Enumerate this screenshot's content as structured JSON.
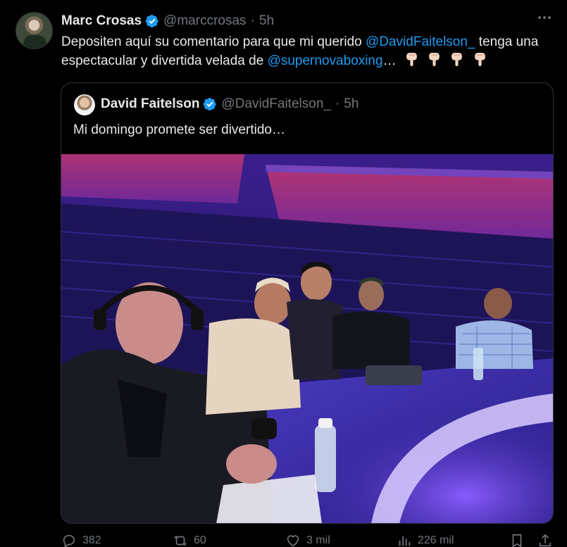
{
  "tweet": {
    "author_name": "Marc Crosas",
    "author_handle": "@marccrosas",
    "separator": "·",
    "time": "5h",
    "text_before": "Depositen aquí su comentario para que mi querido ",
    "mention_1": "@DavidFaitelson_",
    "text_middle": " tenga una espectacular y divertida velada de ",
    "mention_2": "@supernovaboxing",
    "text_after": "…"
  },
  "quote": {
    "author_name": "David Faitelson",
    "author_handle": "@DavidFaitelson_",
    "separator": "·",
    "time": "5h",
    "text": "Mi domingo promete ser divertido…"
  },
  "actions": {
    "replies": "382",
    "reposts": "60",
    "likes": "3 mil",
    "views": "226 mil"
  },
  "icons": {
    "verified": "verified-badge-icon",
    "emoji": "backhand-index-pointing-down-icon",
    "more": "more-options-icon",
    "reply": "reply-icon",
    "repost": "repost-icon",
    "like": "heart-icon",
    "views": "analytics-icon",
    "bookmark": "bookmark-icon",
    "share": "share-icon"
  },
  "colors": {
    "background": "#000000",
    "text": "#e7e9ea",
    "secondary": "#71767b",
    "accent": "#1d9bf0",
    "border": "#2f3336"
  }
}
